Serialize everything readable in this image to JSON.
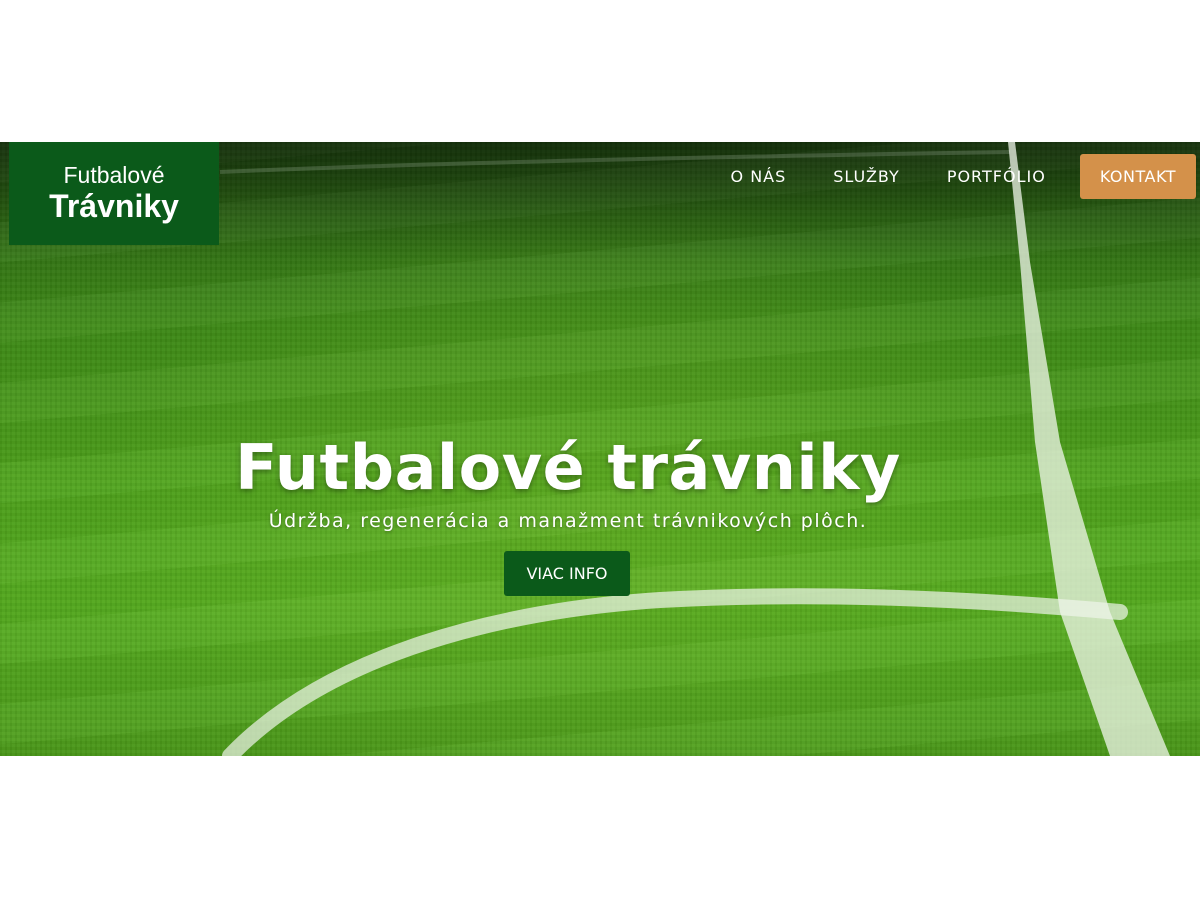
{
  "logo": {
    "line1": "Futbalové",
    "line2": "Trávniky"
  },
  "nav": {
    "items": [
      "O NÁS",
      "SLUŽBY",
      "PORTFÓLIO"
    ],
    "contact_label": "KONTAKT"
  },
  "hero": {
    "title": "Futbalové trávniky",
    "subtitle": "Údržba, regenerácia a manažment trávnikových plôch.",
    "cta_label": "VIAC INFO"
  },
  "colors": {
    "brand_green": "#0b5a1a",
    "accent_orange": "#d4914a",
    "grass_green": "#4ea31b"
  }
}
